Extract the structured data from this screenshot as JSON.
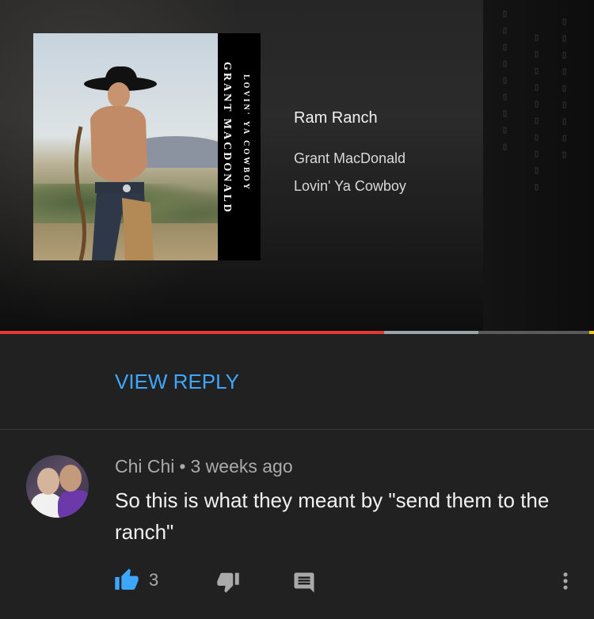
{
  "player": {
    "track_title": "Ram Ranch",
    "artist": "Grant MacDonald",
    "album": "Lovin' Ya Cowboy",
    "cover_spine_artist": "GRANT MACDONALD",
    "cover_spine_album": "LOVIN' YA COWBOY",
    "progress": {
      "played_fraction": 0.647,
      "buffered_fraction": 0.805
    }
  },
  "view_reply_label": "VIEW REPLY",
  "comment": {
    "author": "Chi Chi",
    "separator": "•",
    "time": "3 weeks ago",
    "text": "So this is what they meant by \"send them to the ranch\"",
    "like_count": "3"
  },
  "icons": {
    "like": "thumbs-up-icon",
    "dislike": "thumbs-down-icon",
    "reply": "comment-icon",
    "more": "more-vert-icon"
  },
  "colors": {
    "background": "#212121",
    "link_blue": "#3ea6ff",
    "progress_red": "#e53935",
    "secondary_text": "#aaaaaa",
    "primary_text": "#f1f1f1"
  }
}
